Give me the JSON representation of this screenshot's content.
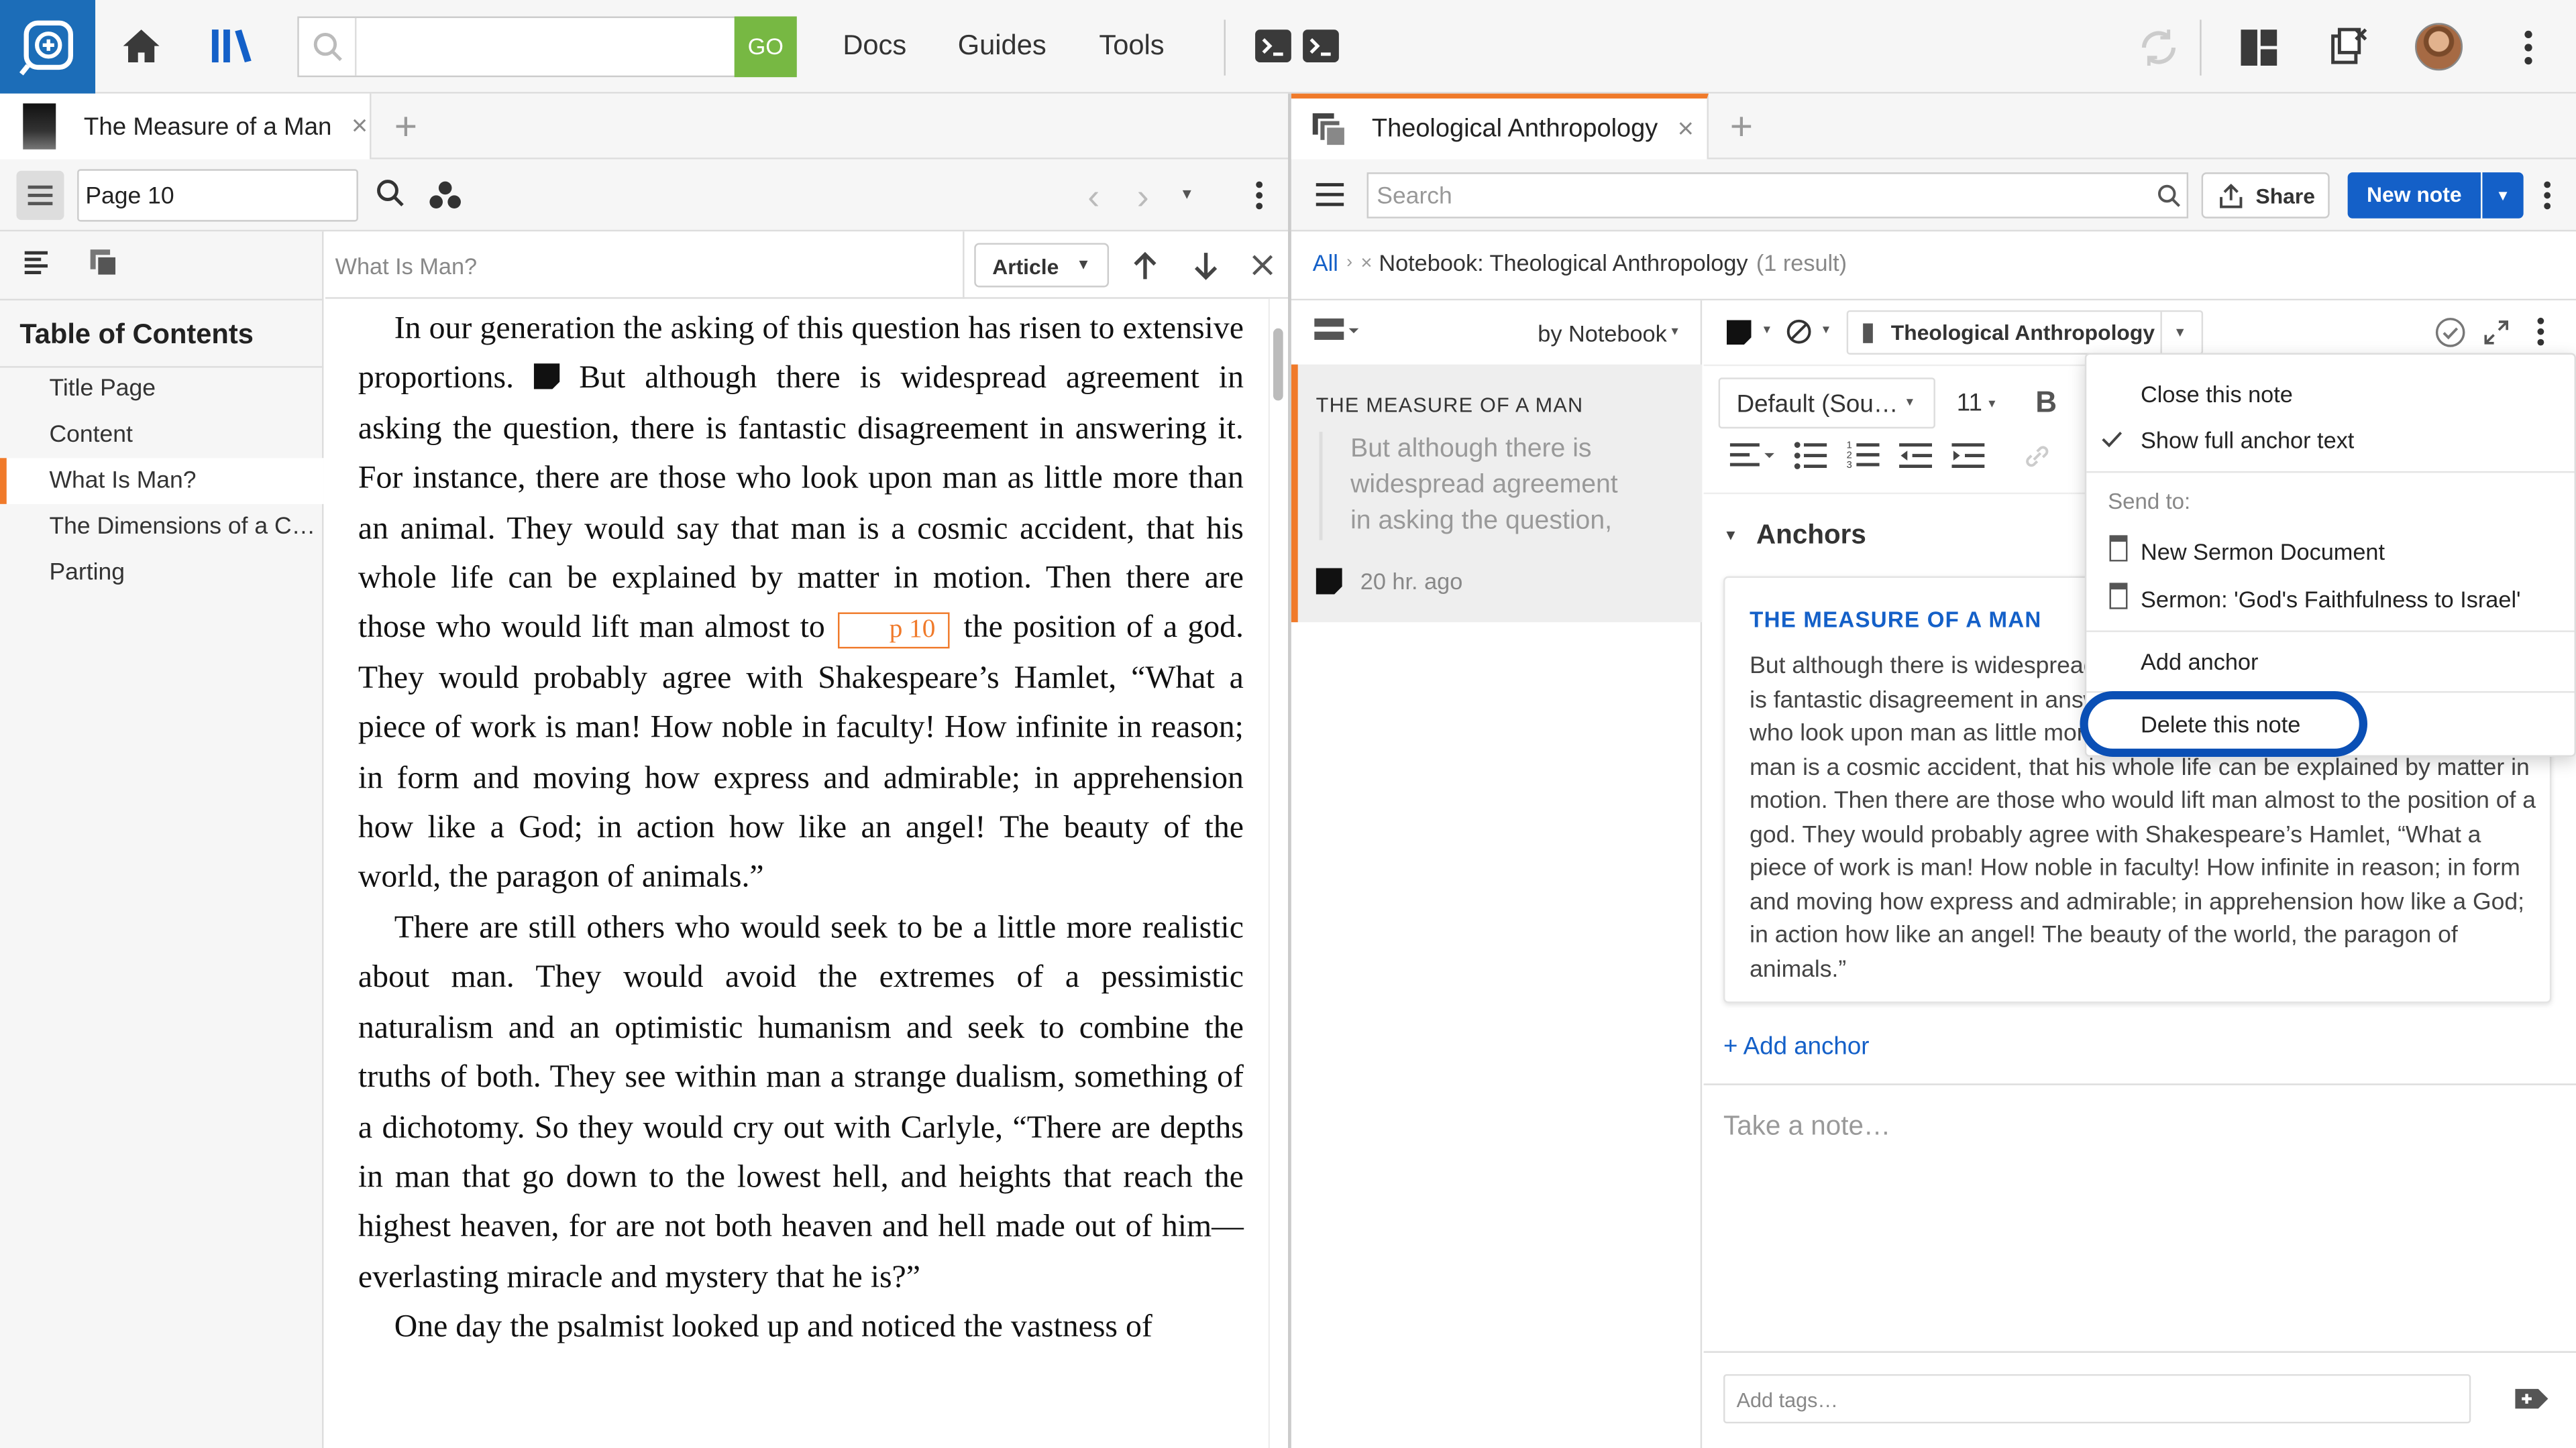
{
  "topbar": {
    "search_placeholder": "",
    "go_label": "GO",
    "nav": [
      "Docs",
      "Guides",
      "Tools"
    ]
  },
  "left": {
    "tab_title": "The Measure of a Man",
    "page_input": "Page 10",
    "find_placeholder": "What Is Man?",
    "article_select": "Article",
    "toc_title": "Table of Contents",
    "toc": [
      "Title Page",
      "Content",
      "What Is Man?",
      "The Dimensions of a C…",
      "Parting"
    ],
    "toc_selected": 2,
    "page_marker": "p 10",
    "para1_a": "In our generation the asking of this question has risen to extensive proportions.",
    "para1_b": "But although there is widespread agreement in asking the question, there is fantastic disagreement in answering it. For instance, there are those who look upon man as little more than an animal. They would say that man is a cosmic accident, that his whole life can be explained by matter in motion. Then there are those who would lift man almost to",
    "para1_c": "the position of a god. They would probably agree with Shakespeare’s Hamlet, “What a piece of work is man! How noble in faculty! How infinite in reason; in form and moving how express and admirable; in apprehension how like a God; in action how like an angel! The beauty of the world, the paragon of animals.”",
    "para2": "There are still others who would seek to be a little more realistic about man. They would avoid the extremes of a pessimistic naturalism and an optimistic humanism and seek to combine the truths of both. They see within man a strange dualism, something of a dichotomy. So they would cry out with Carlyle, “There are depths in man that go down to the lowest hell, and heights that reach the highest heaven, for are not both heaven and hell made out of him—everlasting miracle and mystery that he is?”",
    "para3": "One day the psalmist looked up and noticed the vastness of"
  },
  "right": {
    "tab_title": "Theological Anthropology",
    "search_placeholder": "Search",
    "share_label": "Share",
    "new_note_label": "New note",
    "breadcrumb_all": "All",
    "breadcrumb_notebook": "Notebook: Theological Anthropology",
    "breadcrumb_count": "(1 result)",
    "sort_label": "by Notebook",
    "list_item": {
      "source": "THE MEASURE OF A MAN",
      "excerpt": "But although there is widespread agreement in asking the question, there",
      "time": "20 hr. ago"
    },
    "notebook_select": "Theological Anthropology",
    "font_select": "Default (Sou…",
    "size_select": "11",
    "anchors_heading": "Anchors",
    "anchor_source": "THE MEASURE OF A MAN",
    "anchor_text": "But although there is widespread agreement in asking the question, there is fantastic disagreement in answering it. For instance, there are those who look upon man as little more than an animal. They would say that man is a cosmic accident, that his whole life can be explained by matter in motion. Then there are those who would lift man almost to the position of a god. They would probably agree with Shakespeare’s Hamlet, “What a piece of work is man! How noble in faculty! How infinite in reason; in form and moving how express and admirable; in apprehension how like a God; in action how like an angel! The beauty of the world, the paragon of animals.”",
    "add_anchor": "+ Add anchor",
    "take_note_placeholder": "Take a note…",
    "add_tags_placeholder": "Add tags…"
  },
  "menu": {
    "close_note": "Close this note",
    "show_full_anchor": "Show full anchor text",
    "send_to_label": "Send to:",
    "send_targets": [
      "New Sermon Document",
      "Sermon: 'God's Faithfulness to Israel'"
    ],
    "add_anchor": "Add anchor",
    "delete_note": "Delete this note"
  },
  "colors": {
    "accent_blue": "#1460c8",
    "logo_blue": "#1c6db8",
    "go_green": "#77b843",
    "tab_orange": "#f07a2a",
    "highlight_ring": "#0a4fb5"
  }
}
